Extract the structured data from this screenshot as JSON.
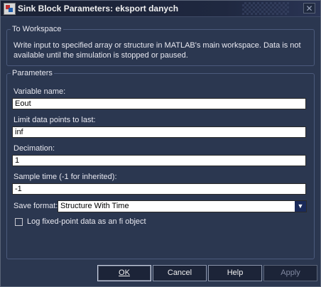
{
  "window": {
    "title": "Sink Block Parameters: eksport danych",
    "close_glyph": "✕",
    "icon": "simulink-block-icon"
  },
  "to_workspace": {
    "group_label": "To Workspace",
    "description": "Write input to specified array or structure in MATLAB's main workspace. Data is not available until the simulation is stopped or paused."
  },
  "parameters": {
    "group_label": "Parameters",
    "variable_name_label": "Variable name:",
    "variable_name_value": "Eout",
    "limit_label": "Limit data points to last:",
    "limit_value": "inf",
    "decimation_label": "Decimation:",
    "decimation_value": "1",
    "sample_time_label": "Sample time (-1 for inherited):",
    "sample_time_value": "-1",
    "save_format_label": "Save format:",
    "save_format_value": "Structure With Time",
    "log_fixed_point_label": "Log fixed-point data as an fi object",
    "log_fixed_point_checked": false
  },
  "buttons": {
    "ok": "OK",
    "cancel": "Cancel",
    "help": "Help",
    "apply": "Apply"
  },
  "colors": {
    "background": "#2b3750",
    "titlebar": "#1f2840"
  }
}
